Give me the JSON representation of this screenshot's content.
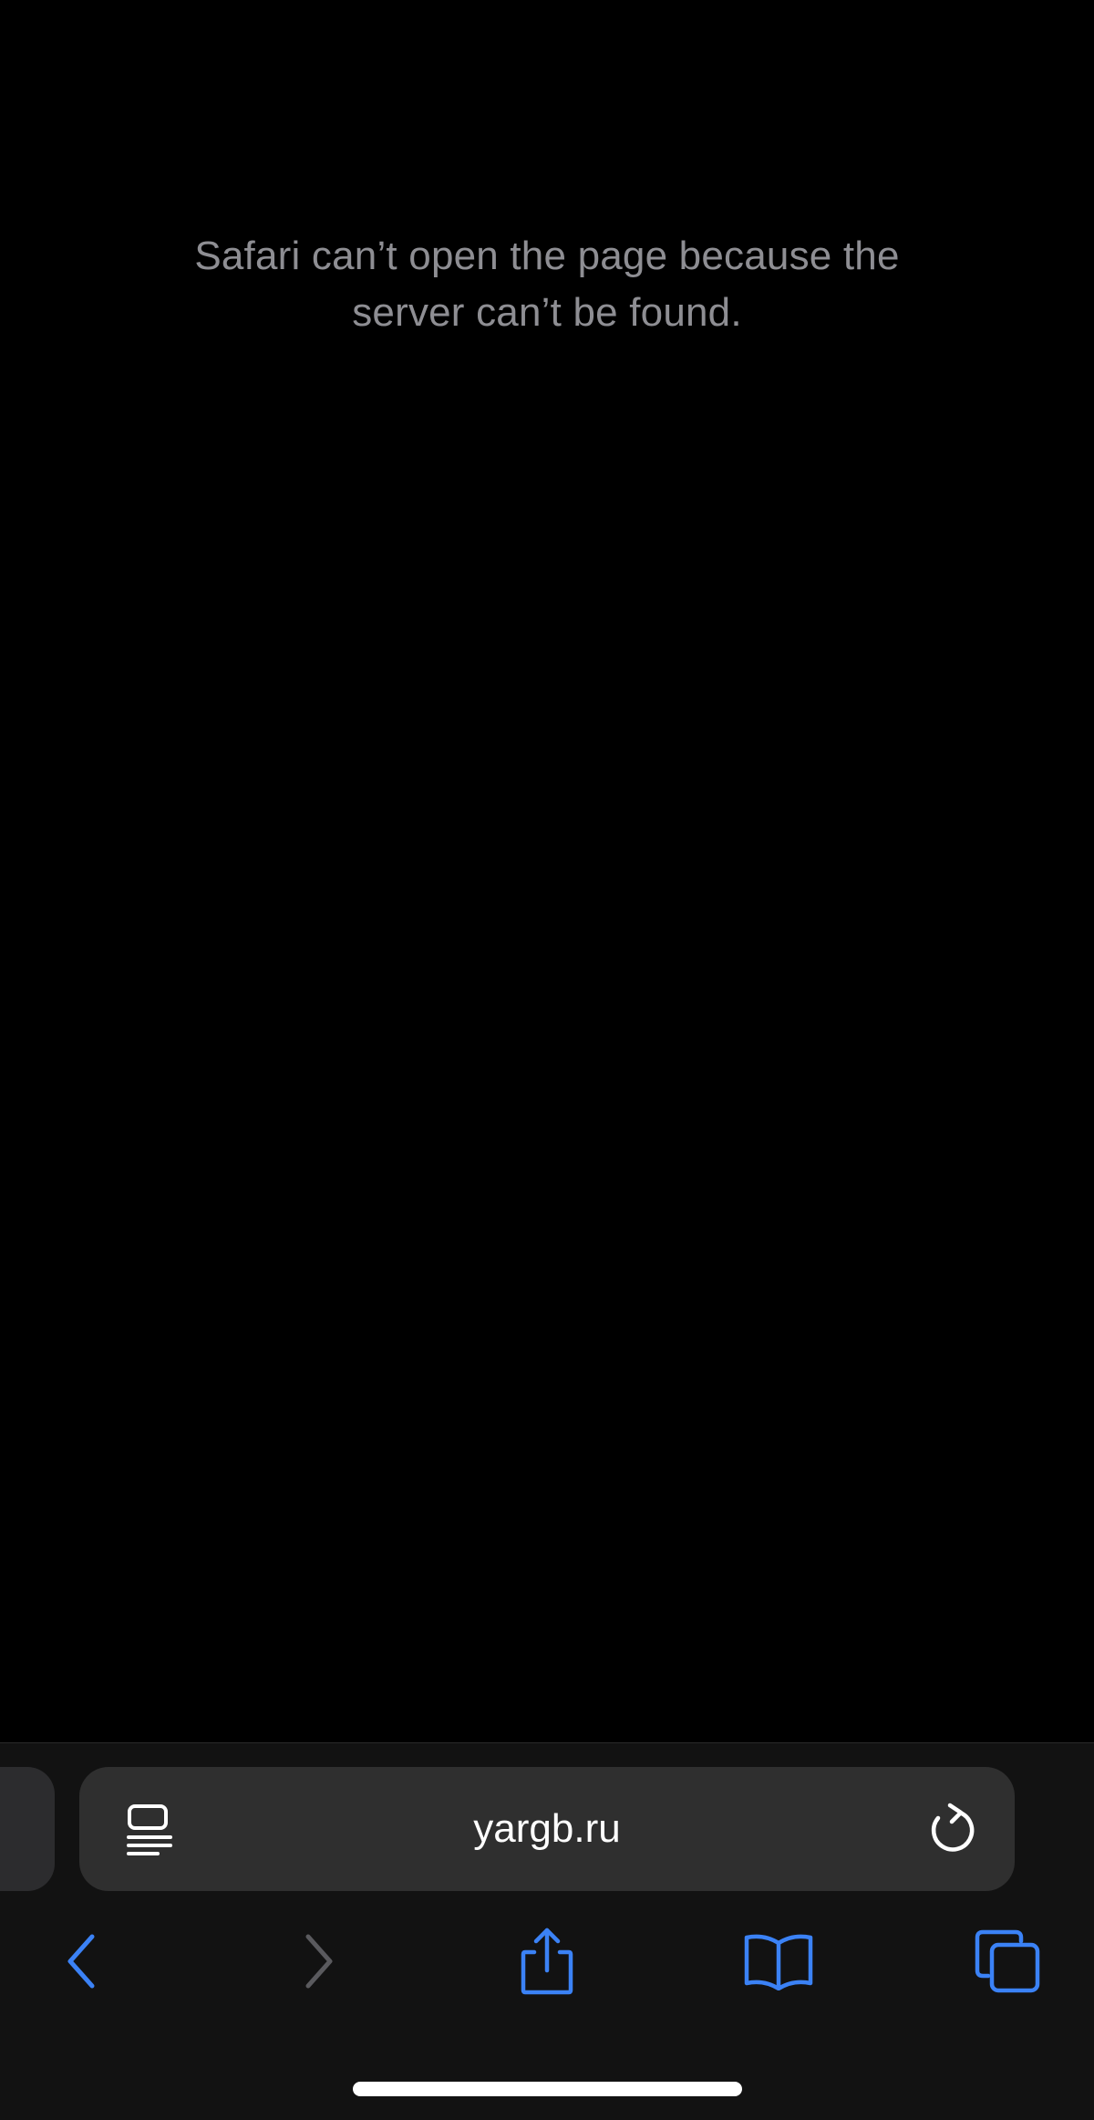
{
  "page": {
    "error_message": "Safari can’t open the page because the server can’t be found."
  },
  "address_bar": {
    "url": "yargb.ru",
    "left_icon": "reader-page-menu-icon",
    "right_icon": "reload-icon"
  },
  "toolbar": {
    "items": [
      {
        "name": "back",
        "icon": "chevron-left-icon",
        "enabled": true
      },
      {
        "name": "forward",
        "icon": "chevron-right-icon",
        "enabled": false
      },
      {
        "name": "share",
        "icon": "share-icon",
        "enabled": true
      },
      {
        "name": "bookmarks",
        "icon": "book-icon",
        "enabled": true
      },
      {
        "name": "tabs",
        "icon": "tabs-icon",
        "enabled": true
      }
    ]
  },
  "colors": {
    "background": "#000000",
    "accent": "#3b82f6",
    "disabled": "#5a5a5e",
    "message_text": "#8e8e93",
    "address_bar": "#2f2f2f"
  }
}
